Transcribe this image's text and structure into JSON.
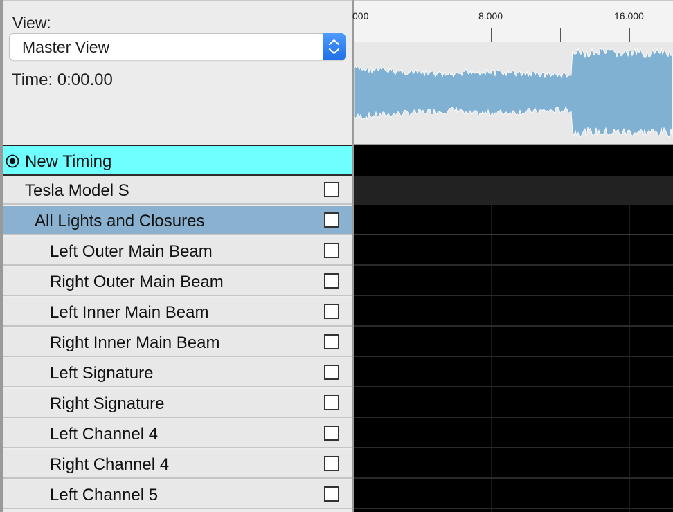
{
  "view": {
    "label": "View:",
    "selected": "Master View"
  },
  "time": {
    "label": "Time: 0:00.00"
  },
  "ruler": {
    "tick_labels": [
      "000",
      "8.000",
      "16.000"
    ]
  },
  "colors": {
    "timing_row": "#6fffff",
    "group_row": "#8ab1cf",
    "waveform_fill": "#80b0d2",
    "select_accent": "#2f7ef5"
  },
  "rows": [
    {
      "type": "timing",
      "label": "New Timing",
      "icon": "radio-target-icon"
    },
    {
      "type": "model",
      "label": "Tesla Model S",
      "checked": false
    },
    {
      "type": "group",
      "label": "All Lights and Closures",
      "checked": false
    },
    {
      "type": "channel",
      "label": "Left Outer Main Beam",
      "checked": false
    },
    {
      "type": "channel",
      "label": "Right Outer Main Beam",
      "checked": false
    },
    {
      "type": "channel",
      "label": "Left Inner Main Beam",
      "checked": false
    },
    {
      "type": "channel",
      "label": "Right Inner Main Beam",
      "checked": false
    },
    {
      "type": "channel",
      "label": "Left Signature",
      "checked": false
    },
    {
      "type": "channel",
      "label": "Right Signature",
      "checked": false
    },
    {
      "type": "channel",
      "label": "Left Channel 4",
      "checked": false
    },
    {
      "type": "channel",
      "label": "Right Channel 4",
      "checked": false
    },
    {
      "type": "channel",
      "label": "Left Channel 5",
      "checked": false
    }
  ]
}
